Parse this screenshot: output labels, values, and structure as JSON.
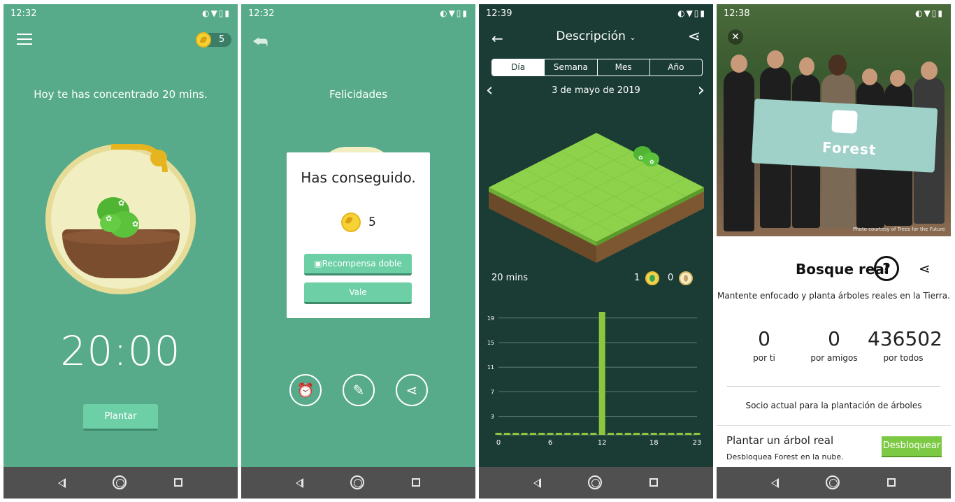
{
  "screens": {
    "s1": {
      "status_time": "12:32",
      "coins": "5",
      "headline": "Hoy te has concentrado 20 mins.",
      "timer": "20:00",
      "plant_button": "Plantar"
    },
    "s2": {
      "status_time": "12:32",
      "headline": "Felicidades",
      "dialog_title": "Has conseguido.",
      "dialog_coins": "5",
      "double_reward_button": "Recompensa doble",
      "ok_button": "Vale"
    },
    "s3": {
      "status_time": "12:39",
      "title": "Descripción",
      "tabs": [
        "Día",
        "Semana",
        "Mes",
        "Año"
      ],
      "active_tab": "Día",
      "date": "3 de mayo de 2019",
      "total_time": "20 mins",
      "healthy_trees": "1",
      "dead_trees": "0"
    },
    "s4": {
      "status_time": "12:38",
      "photo_credit": "Photo courtesy of Trees for the Future",
      "banner_text": "Forest",
      "title": "Bosque real",
      "subtitle": "Mantente enfocado y planta árboles reales en la Tierra.",
      "stats": [
        {
          "value": "0",
          "label": "por ti"
        },
        {
          "value": "0",
          "label": "por amigos"
        },
        {
          "value": "436502",
          "label": "por todos"
        }
      ],
      "partner_text": "Socio actual para la plantación de árboles",
      "card_title": "Plantar un árbol real",
      "card_subtitle": "Desbloquea Forest en la nube.",
      "unlock_button": "Desbloquear"
    }
  },
  "colors": {
    "forest_green": "#57ab8a",
    "dark_bg": "#1a3c34",
    "button_green": "#6ccfa6",
    "bar_green": "#8cc63f",
    "coin_gold": "#f6d234"
  },
  "chart_data": {
    "type": "bar",
    "x": [
      0,
      1,
      2,
      3,
      4,
      5,
      6,
      7,
      8,
      9,
      10,
      11,
      12,
      13,
      14,
      15,
      16,
      17,
      18,
      19,
      20,
      21,
      22,
      23
    ],
    "values": [
      0,
      0,
      0,
      0,
      0,
      0,
      0,
      0,
      0,
      0,
      0,
      0,
      20,
      0,
      0,
      0,
      0,
      0,
      0,
      0,
      0,
      0,
      0,
      0
    ],
    "xticks": [
      "0",
      "6",
      "12",
      "18",
      "23"
    ],
    "yticks": [
      "3",
      "7",
      "11",
      "15",
      "19"
    ],
    "ylim": [
      0,
      20
    ],
    "grid": true
  }
}
